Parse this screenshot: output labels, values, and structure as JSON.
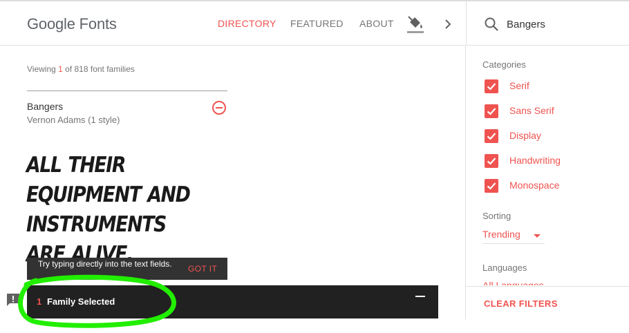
{
  "header": {
    "logo_google": "Google",
    "logo_fonts": "Fonts",
    "nav": [
      {
        "label": "DIRECTORY",
        "active": true
      },
      {
        "label": "FEATURED",
        "active": false
      },
      {
        "label": "ABOUT",
        "active": false
      }
    ]
  },
  "search": {
    "value": "Bangers"
  },
  "viewing": {
    "prefix": "Viewing ",
    "count": "1",
    "suffix": " of 818 font families"
  },
  "font_card": {
    "name": "Bangers",
    "author": "Vernon Adams (1 style)",
    "sample_text": "All their equipment and instruments are alive."
  },
  "toast": {
    "message": "Try typing directly into the text fields.",
    "action": "GOT IT"
  },
  "tray": {
    "count": "1",
    "label": "Family Selected"
  },
  "sidebar": {
    "categories_title": "Categories",
    "categories": [
      {
        "label": "Serif",
        "checked": true
      },
      {
        "label": "Sans Serif",
        "checked": true
      },
      {
        "label": "Display",
        "checked": true
      },
      {
        "label": "Handwriting",
        "checked": true
      },
      {
        "label": "Monospace",
        "checked": true
      }
    ],
    "sorting_title": "Sorting",
    "sorting_value": "Trending",
    "languages_title": "Languages",
    "languages_value": "All Languages",
    "clear_filters": "CLEAR FILTERS"
  },
  "colors": {
    "accent": "#ef5350",
    "tray_bg": "#212121",
    "highlight": "#00ff00"
  }
}
